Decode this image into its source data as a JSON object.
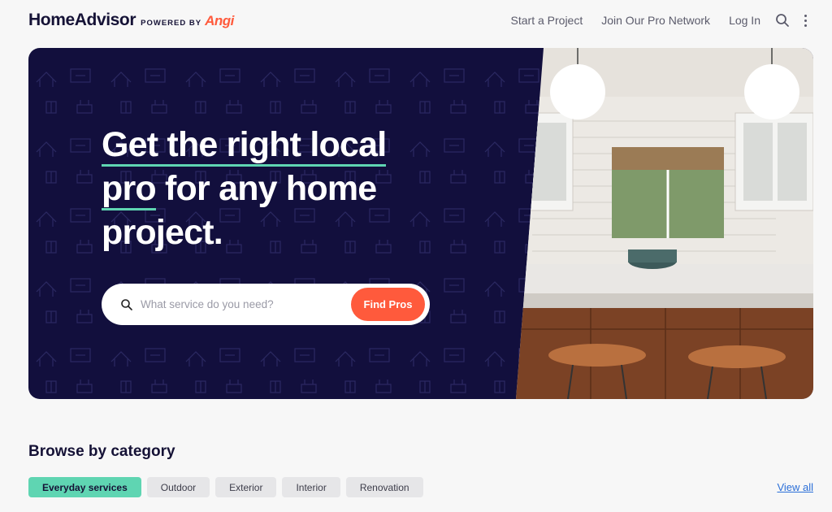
{
  "brand": {
    "name": "HomeAdvisor",
    "powered": "POWERED BY",
    "partner": "Angi",
    "accent": "#ff5a3c"
  },
  "nav": {
    "items": [
      "Start a Project",
      "Join Our Pro Network",
      "Log In"
    ],
    "icons": [
      "search-icon",
      "more-vertical-icon"
    ]
  },
  "hero": {
    "headline_1": "Get the right local",
    "headline_2a": "pro",
    "headline_2b": " for any home",
    "headline_3": "project.",
    "background": "#120f3d",
    "underline_color": "#5fd5b2",
    "search": {
      "placeholder": "What service do you need?",
      "value": "",
      "button": "Find Pros"
    }
  },
  "browse": {
    "title": "Browse by category",
    "categories": [
      "Everyday services",
      "Outdoor",
      "Exterior",
      "Interior",
      "Renovation"
    ],
    "active": "Everyday services",
    "view_all": "View all"
  }
}
